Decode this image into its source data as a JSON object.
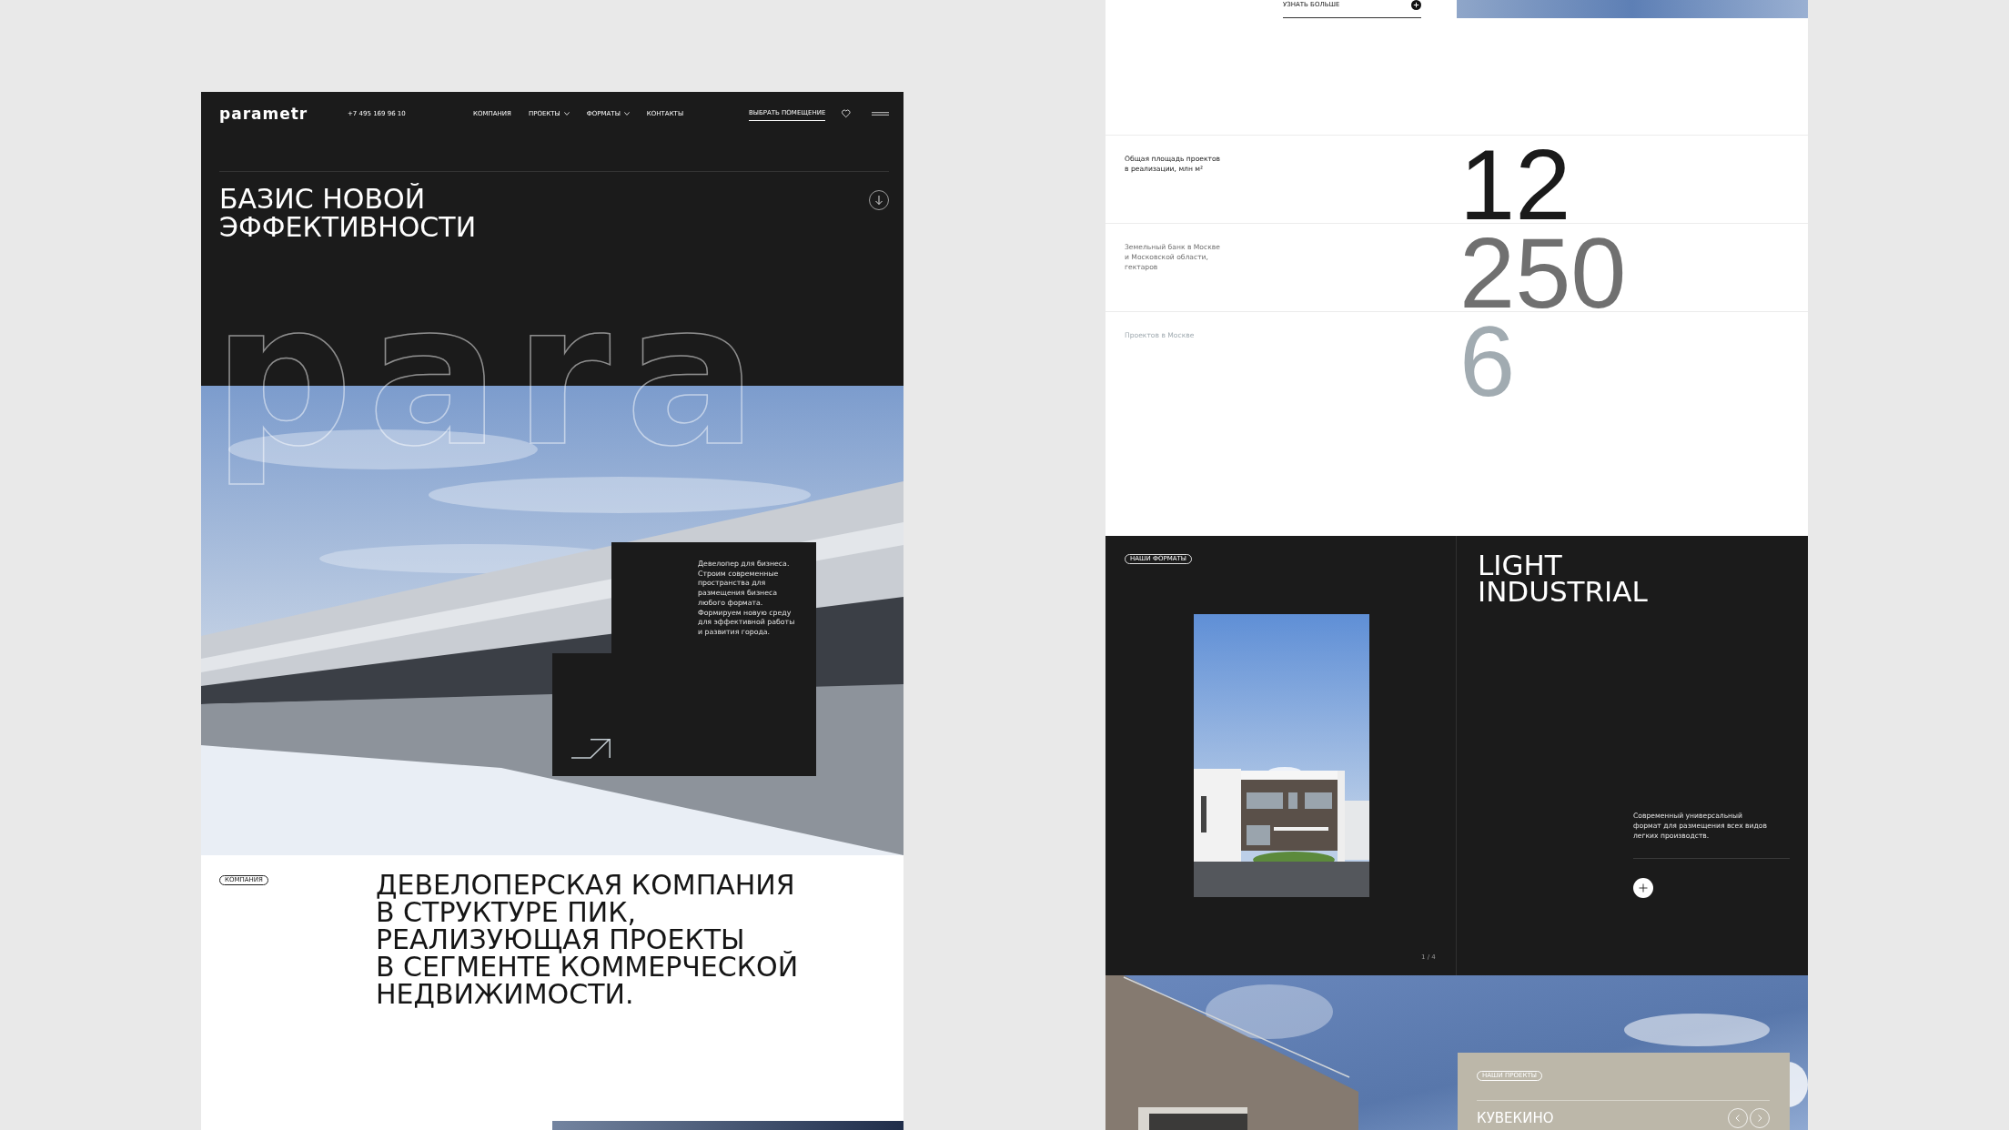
{
  "left_page": {
    "header": {
      "logo": "parametr",
      "phone": "+7 495 169 96 10",
      "nav": [
        {
          "label": "КОМПАНИЯ",
          "has_dropdown": false
        },
        {
          "label": "ПРОЕКТЫ",
          "has_dropdown": true
        },
        {
          "label": "ФОРМАТЫ",
          "has_dropdown": true
        },
        {
          "label": "КОНТАКТЫ",
          "has_dropdown": false
        }
      ],
      "cta": "ВЫБРАТЬ ПОМЕЩЕНИЕ"
    },
    "hero": {
      "title": "БАЗИС НОВОЙ\nЭФФЕКТИВНОСТИ",
      "outline_word": "para",
      "card_text": "Девелопер для бизнеса.\nСтроим современные\nпространства для\nразмещения бизнеса\nлюбого формата.\nФормируем новую среду\nдля эффективной работы\nи развития города."
    },
    "about": {
      "tag": "КОМПАНИЯ",
      "text": "ДЕВЕЛОПЕРСКАЯ КОМПАНИЯ\nВ СТРУКТУРЕ ПИК,\nРЕАЛИЗУЮЩАЯ ПРОЕКТЫ\nВ СЕГМЕНТЕ КОММЕРЧЕСКОЙ\nНЕДВИЖИМОСТИ."
    }
  },
  "right_page": {
    "more_link": "УЗНАТЬ БОЛЬШЕ",
    "stats": [
      {
        "label": "Общая площадь проектов\nв реализации, млн м²",
        "value": "12",
        "color": "#1a1a1a"
      },
      {
        "label": "Земельный банк в Москве\nи Московской области,\nгектаров",
        "value": "250",
        "color": "#707070"
      },
      {
        "label": "Проектов в Москве",
        "value": "6",
        "color": "#a1abb1"
      }
    ],
    "formats": {
      "tag": "НАШИ ФОРМАТЫ",
      "pager": "1 / 4",
      "title": "LIGHT\nINDUSTRIAL",
      "description": "Современный универсальный\nформат для размещения всех видов\nлегких производств."
    },
    "projects": {
      "tag": "НАШИ ПРОЕКТЫ",
      "title": "КУВЕКИНО"
    }
  }
}
